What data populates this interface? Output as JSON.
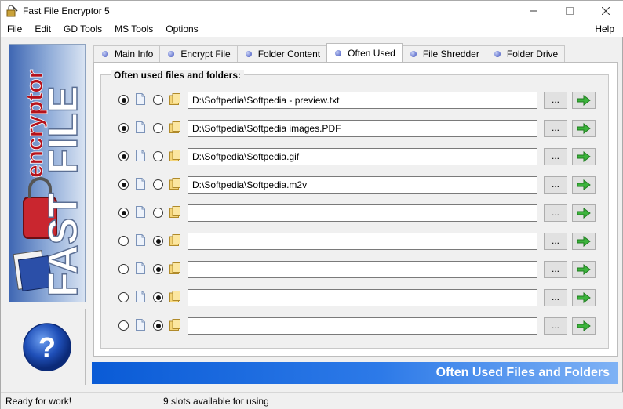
{
  "window": {
    "title": "Fast File Encryptor 5"
  },
  "menu": {
    "items": [
      "File",
      "Edit",
      "GD Tools",
      "MS Tools",
      "Options"
    ],
    "help": "Help"
  },
  "tabs": [
    {
      "label": "Main Info",
      "active": false
    },
    {
      "label": "Encrypt File",
      "active": false
    },
    {
      "label": "Folder Content",
      "active": false
    },
    {
      "label": "Often Used",
      "active": true
    },
    {
      "label": "File Shredder",
      "active": false
    },
    {
      "label": "Folder Drive",
      "active": false
    }
  ],
  "group": {
    "title": "Often used files and folders:"
  },
  "rows": [
    {
      "path": "D:\\Softpedia\\Softpedia - preview.txt",
      "selected": "file",
      "browse": "...",
      "go": "go-arrow-icon"
    },
    {
      "path": "D:\\Softpedia\\Softpedia images.PDF",
      "selected": "file",
      "browse": "...",
      "go": "go-arrow-icon"
    },
    {
      "path": "D:\\Softpedia\\Softpedia.gif",
      "selected": "file",
      "browse": "...",
      "go": "go-arrow-icon"
    },
    {
      "path": "D:\\Softpedia\\Softpedia.m2v",
      "selected": "file",
      "browse": "...",
      "go": "go-arrow-icon"
    },
    {
      "path": "",
      "selected": "file",
      "browse": "...",
      "go": "go-arrow-icon"
    },
    {
      "path": "",
      "selected": "folder",
      "browse": "...",
      "go": "go-arrow-icon"
    },
    {
      "path": "",
      "selected": "folder",
      "browse": "...",
      "go": "go-arrow-icon"
    },
    {
      "path": "",
      "selected": "folder",
      "browse": "...",
      "go": "go-arrow-icon"
    },
    {
      "path": "",
      "selected": "folder",
      "browse": "...",
      "go": "go-arrow-icon"
    }
  ],
  "banner": {
    "text": "Often Used Files and Folders"
  },
  "status": {
    "left": "Ready for work!",
    "right": "9 slots available for using"
  },
  "logo": {
    "word1": "FAST",
    "word2": "FILE",
    "word3": "encryptor"
  },
  "help_glyph": "?",
  "colors": {
    "accent": "#0a5bd6",
    "go_green": "#3cb43c",
    "tab_dot": "#6f7fd4"
  }
}
